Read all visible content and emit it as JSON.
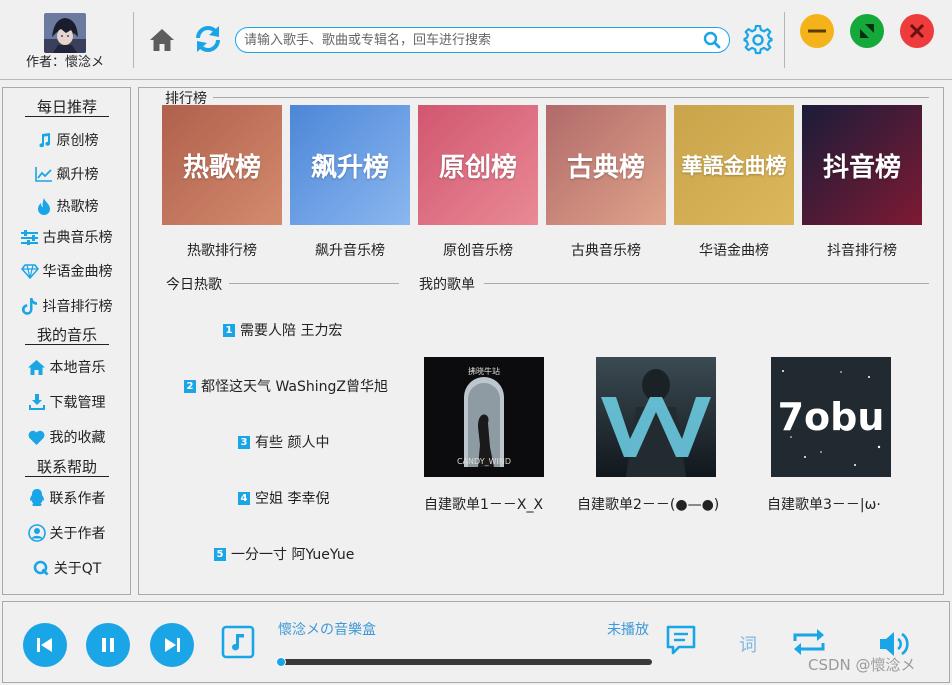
{
  "header": {
    "author": "作者：懷淰メ",
    "search_placeholder": "请输入歌手、歌曲或专辑名，回车进行搜索",
    "icons": [
      "home-icon",
      "refresh-icon",
      "search-icon",
      "gear-icon",
      "minimize-icon",
      "maximize-icon",
      "close-icon"
    ],
    "colors": {
      "accent": "#1aa5e6",
      "minimize": "#f5b31b",
      "maximize": "#15a83a",
      "close": "#ee3b3b"
    }
  },
  "sidebar": {
    "daily_title": "每日推荐",
    "daily_items": [
      {
        "label": "原创榜",
        "icon": "music-note-icon"
      },
      {
        "label": "飙升榜",
        "icon": "trend-chart-icon"
      },
      {
        "label": "热歌榜",
        "icon": "flame-icon"
      },
      {
        "label": "古典音乐榜",
        "icon": "sliders-icon"
      },
      {
        "label": "华语金曲榜",
        "icon": "diamond-icon"
      },
      {
        "label": "抖音排行榜",
        "icon": "tiktok-icon"
      }
    ],
    "my_music_title": "我的音乐",
    "my_music_items": [
      {
        "label": "本地音乐",
        "icon": "house-icon"
      },
      {
        "label": "下载管理",
        "icon": "download-icon"
      },
      {
        "label": "我的收藏",
        "icon": "heart-icon"
      }
    ],
    "help_title": "联系帮助",
    "help_items": [
      {
        "label": "联系作者",
        "icon": "qq-penguin-icon"
      },
      {
        "label": "关于作者",
        "icon": "user-circle-icon"
      },
      {
        "label": "关于QT",
        "icon": "qt-logo-icon"
      }
    ]
  },
  "main": {
    "charts_title": "排行榜",
    "charts": [
      {
        "cover_text": "热歌榜",
        "label": "热歌排行榜",
        "colors": [
          "#b0604c",
          "#d38b6e"
        ]
      },
      {
        "cover_text": "飙升榜",
        "label": "飙升音乐榜",
        "colors": [
          "#4d86d8",
          "#8ab7ef"
        ]
      },
      {
        "cover_text": "原创榜",
        "label": "原创音乐榜",
        "colors": [
          "#d1566f",
          "#e98a96"
        ]
      },
      {
        "cover_text": "古典榜",
        "label": "古典音乐榜",
        "colors": [
          "#b06a6a",
          "#e0a38a"
        ]
      },
      {
        "cover_text": "華語金曲榜",
        "label": "华语金曲榜",
        "colors": [
          "#c9a44a",
          "#dcb75c"
        ]
      },
      {
        "cover_text": "抖音榜",
        "label": "抖音排行榜",
        "colors": [
          "#1a1c3a",
          "#7e1a33"
        ]
      }
    ],
    "today_title": "今日热歌",
    "hot_songs": [
      {
        "num": "1",
        "text": "需要人陪 王力宏"
      },
      {
        "num": "2",
        "text": "都怪这天气 WaShingZ曾华旭"
      },
      {
        "num": "3",
        "text": "有些 颜人中"
      },
      {
        "num": "4",
        "text": "空姐 李幸倪"
      },
      {
        "num": "5",
        "text": "一分一寸 阿YueYue"
      }
    ],
    "playlists_title": "我的歌单",
    "playlists": [
      {
        "name": "自建歌单1－－X_X",
        "cover_top": "拂晓牛站",
        "cover_bottom": "CANDY_WIND"
      },
      {
        "name": "自建歌单2－－(●—●)",
        "cover_top": "",
        "cover_bottom": ""
      },
      {
        "name": "自建歌单3－－|ω·",
        "cover_top": "",
        "cover_bottom": "7obu"
      }
    ]
  },
  "player": {
    "now_playing": "懷淰メの音樂盒",
    "status": "未播放",
    "lyric_label": "词",
    "progress": 0,
    "icons": [
      "previous-icon",
      "pause-icon",
      "next-icon",
      "music-note-icon",
      "comment-icon",
      "loop-icon",
      "volume-icon"
    ]
  },
  "watermark": "CSDN @懷淰メ"
}
